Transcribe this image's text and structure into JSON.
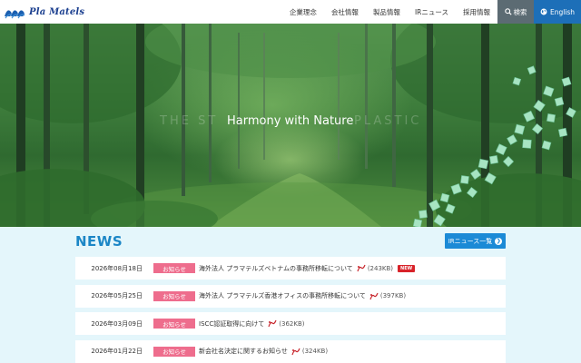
{
  "header": {
    "brand": "Pla Matels",
    "nav": [
      "企業理念",
      "会社情報",
      "製品情報",
      "IRニュース",
      "採用情報"
    ],
    "search_label": "検索",
    "english_label": "English"
  },
  "hero": {
    "title": "Harmony with Nature",
    "ghost_left": "THE ST",
    "ghost_right": "PLASTIC"
  },
  "news": {
    "title": "NEWS",
    "ir_button": "IRニュース一覧",
    "items": [
      {
        "date": "2026年08月18日",
        "category": "お知らせ",
        "text": "海外法人 プラマテルズベトナムの事務所移転について",
        "size": "(243KB)",
        "new": "NEW"
      },
      {
        "date": "2026年05月25日",
        "category": "お知らせ",
        "text": "海外法人 プラマテルズ香港オフィスの事務所移転について",
        "size": "(397KB)"
      },
      {
        "date": "2026年03月09日",
        "category": "お知らせ",
        "text": "ISCC認証取得に向けて",
        "size": "(362KB)"
      },
      {
        "date": "2026年01月22日",
        "category": "お知らせ",
        "text": "新会社名決定に関するお知らせ",
        "size": "(324KB)"
      }
    ]
  },
  "colors": {
    "brand_blue": "#1b3f8f",
    "news_blue": "#1b86c6",
    "badge_pink": "#ee6d8d",
    "new_red": "#d8232a",
    "english_bg": "#1d6fb8",
    "search_bg": "#5c6b73"
  },
  "icons": [
    "logo-mark",
    "search-icon",
    "globe-icon",
    "arrow-right-circle-icon",
    "pdf-icon"
  ]
}
